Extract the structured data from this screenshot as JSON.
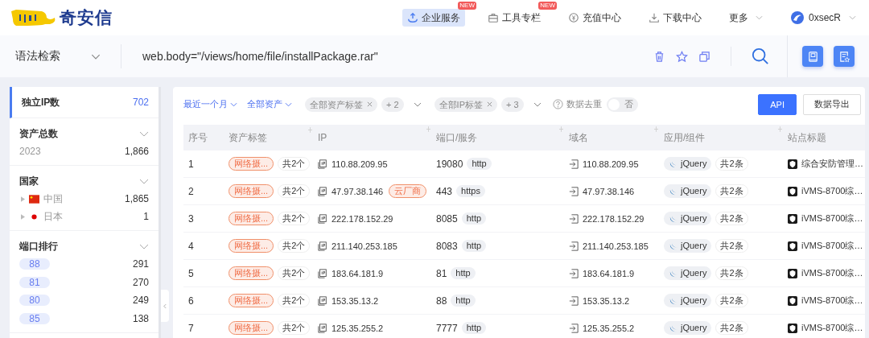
{
  "brand": {
    "name": "奇安信"
  },
  "nav": {
    "items": [
      {
        "label": "企业服务",
        "badge": "NEW",
        "selected": true
      },
      {
        "label": "工具专栏",
        "badge": "NEW",
        "selected": false
      },
      {
        "label": "充值中心",
        "selected": false
      },
      {
        "label": "下载中心",
        "selected": false
      }
    ],
    "more": "更多",
    "user": "0xsecR"
  },
  "search": {
    "mode": "语法检索",
    "query": "web.body=\"/views/home/file/installPackage.rar\""
  },
  "sidebar": {
    "metric": {
      "label": "独立IP数",
      "value": "702",
      "selected": true
    },
    "sections": [
      {
        "kind": "list",
        "title": "资产总数",
        "expanded": false,
        "items": [
          {
            "label": "2023",
            "value": "1,866"
          }
        ]
      },
      {
        "kind": "tree",
        "title": "国家",
        "expanded": false,
        "items": [
          {
            "label": "中国",
            "value": "1,865"
          },
          {
            "label": "日本",
            "value": "1"
          }
        ]
      },
      {
        "kind": "pills",
        "title": "端口排行",
        "expanded": false,
        "items": [
          {
            "label": "88",
            "value": "291"
          },
          {
            "label": "81",
            "value": "270"
          },
          {
            "label": "80",
            "value": "249"
          },
          {
            "label": "85",
            "value": "138"
          }
        ]
      }
    ]
  },
  "filters": [
    {
      "kind": "dropdown",
      "label": "最近一个月"
    },
    {
      "kind": "dropdown",
      "label": "全部资产"
    },
    {
      "kind": "tags",
      "tag": "全部资产标签",
      "more": "+ 2"
    },
    {
      "kind": "tags",
      "tag": "全部IP标签",
      "more": "+ 3"
    }
  ],
  "dedupe": {
    "label": "数据去重",
    "on": false,
    "state": "否"
  },
  "buttons": [
    {
      "label": "API",
      "primary": true
    },
    {
      "label": "数据导出",
      "primary": false
    }
  ],
  "table": {
    "columns": [
      "序号",
      "资产标签",
      "IP",
      "端口/服务",
      "域名",
      "应用/组件",
      "站点标题"
    ],
    "rows": [
      {
        "no": "1",
        "tag": "网络摄...",
        "tag_count": "共2个",
        "ip": "110.88.209.95",
        "port": "19080",
        "service": "http",
        "domain": "110.88.209.95",
        "app": "jQuery",
        "app_count": "共2条",
        "title": "综合安防管理…"
      },
      {
        "no": "2",
        "tag": "网络摄...",
        "tag_count": "共2个",
        "ip": "47.97.38.146",
        "ip_badge": "云厂商",
        "port": "443",
        "service": "https",
        "domain": "47.97.38.146",
        "app": "jQuery",
        "app_count": "共2条",
        "title": "iVMS-8700综…"
      },
      {
        "no": "3",
        "tag": "网络摄...",
        "tag_count": "共2个",
        "ip": "222.178.152.29",
        "port": "8085",
        "service": "http",
        "domain": "222.178.152.29",
        "app": "jQuery",
        "app_count": "共2条",
        "title": "iVMS-8700综…"
      },
      {
        "no": "4",
        "tag": "网络摄...",
        "tag_count": "共2个",
        "ip": "211.140.253.185",
        "port": "8083",
        "service": "http",
        "domain": "211.140.253.185",
        "app": "jQuery",
        "app_count": "共2条",
        "title": "iVMS-8700综…"
      },
      {
        "no": "5",
        "tag": "网络摄...",
        "tag_count": "共2个",
        "ip": "183.64.181.9",
        "port": "81",
        "service": "http",
        "domain": "183.64.181.9",
        "app": "jQuery",
        "app_count": "共2条",
        "title": "iVMS-8700综…"
      },
      {
        "no": "6",
        "tag": "网络摄...",
        "tag_count": "共2个",
        "ip": "153.35.13.2",
        "port": "88",
        "service": "http",
        "domain": "153.35.13.2",
        "app": "jQuery",
        "app_count": "共2条",
        "title": "iVMS-8700综…"
      },
      {
        "no": "7",
        "tag": "网络摄...",
        "tag_count": "共2个",
        "ip": "125.35.255.2",
        "port": "7777",
        "service": "http",
        "domain": "125.35.255.2",
        "app": "jQuery",
        "app_count": "共2条",
        "title": "iVMS-8700综…"
      }
    ]
  }
}
